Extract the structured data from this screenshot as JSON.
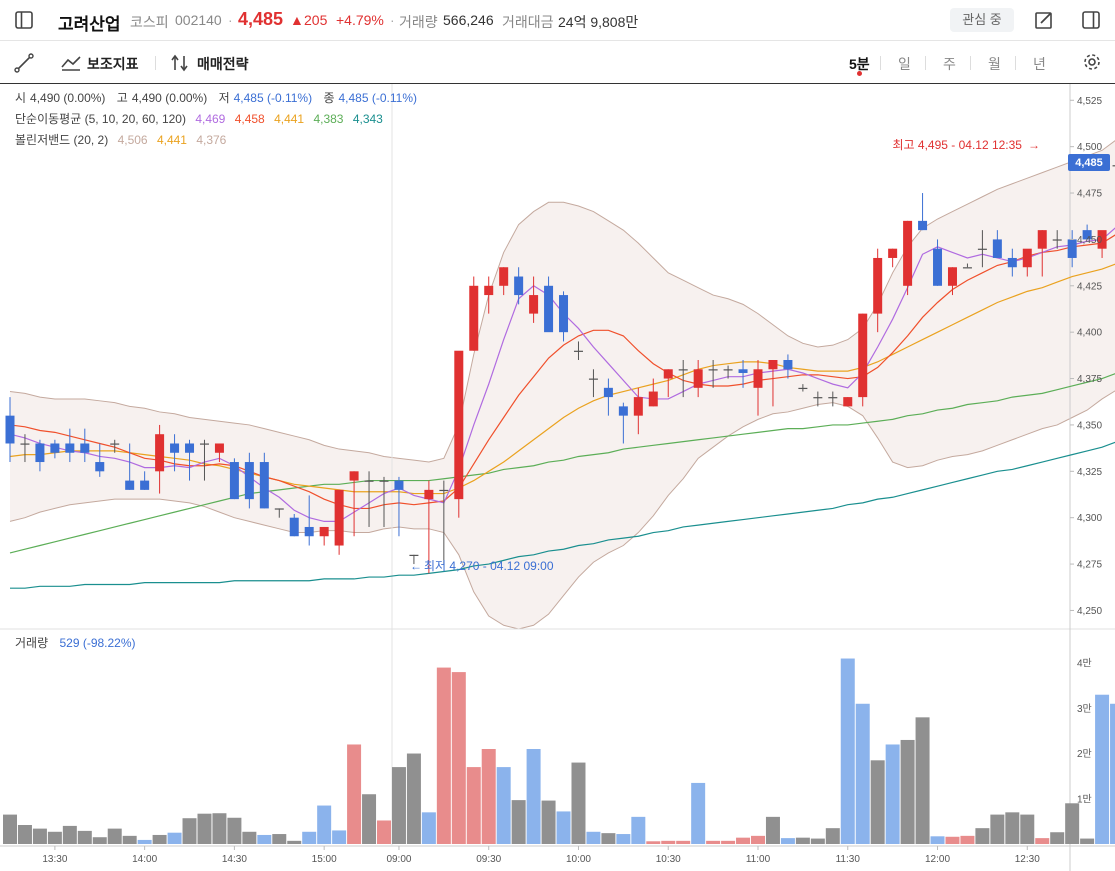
{
  "header": {
    "name": "고려산업",
    "market": "코스피",
    "code": "002140",
    "price": "4,485",
    "change": "205",
    "change_pct": "+4.79%",
    "volume_label": "거래량",
    "volume": "566,246",
    "amount_label": "거래대금",
    "amount": "24억 9,808만",
    "fav_label": "관심 중"
  },
  "toolbar": {
    "indicator_label": "보조지표",
    "strategy_label": "매매전략",
    "periods": [
      "5분",
      "일",
      "주",
      "월",
      "년"
    ],
    "active_period": "5분"
  },
  "legend": {
    "ohlc": [
      {
        "label": "시",
        "value": "4,490 (0.00%)",
        "color": "#444444"
      },
      {
        "label": "고",
        "value": "4,490 (0.00%)",
        "color": "#444444"
      },
      {
        "label": "저",
        "value": "4,485 (-0.11%)",
        "color": "#3b6fd4"
      },
      {
        "label": "종",
        "value": "4,485 (-0.11%)",
        "color": "#3b6fd4"
      }
    ],
    "sma_label": "단순이동평균 (5, 10, 20, 60, 120)",
    "sma_values": [
      {
        "value": "4,469",
        "color": "#b06be0"
      },
      {
        "value": "4,458",
        "color": "#f0502c"
      },
      {
        "value": "4,441",
        "color": "#eaa21f"
      },
      {
        "value": "4,383",
        "color": "#5cae57"
      },
      {
        "value": "4,343",
        "color": "#1a8f8f"
      }
    ],
    "bb_label": "볼린저밴드 (20, 2)",
    "bb_values": [
      {
        "value": "4,506",
        "color": "#c4a99e"
      },
      {
        "value": "4,441",
        "color": "#eaa21f"
      },
      {
        "value": "4,376",
        "color": "#c4a99e"
      }
    ],
    "volume_label": "거래량",
    "volume_value": "529 (-98.22%)"
  },
  "annotations": {
    "high": "최고 4,495 - 04.12 12:35",
    "low": "최저 4,270 - 04.12 09:00",
    "current_price_tag": "4,485"
  },
  "colors": {
    "up": "#e03131",
    "down": "#3b6fd4",
    "neutral": "#555555"
  },
  "chart_data": [
    {
      "type": "candlestick",
      "ylim": [
        4240,
        4530
      ],
      "y_ticks": [
        "4,525",
        "4,500",
        "4,475",
        "4,450",
        "4,425",
        "4,400",
        "4,375",
        "4,350",
        "4,325",
        "4,300",
        "4,275",
        "4,250"
      ],
      "x_ticks": [
        "13:30",
        "14:00",
        "14:30",
        "15:00",
        "09:00",
        "09:30",
        "10:00",
        "10:30",
        "11:00",
        "11:30",
        "12:00",
        "12:30"
      ],
      "candles": [
        [
          4355,
          4365,
          4330,
          4340
        ],
        [
          4340,
          4345,
          4330,
          4340
        ],
        [
          4340,
          4342,
          4325,
          4330
        ],
        [
          4340,
          4342,
          4332,
          4335
        ],
        [
          4340,
          4348,
          4330,
          4335
        ],
        [
          4340,
          4348,
          4330,
          4335
        ],
        [
          4330,
          4340,
          4322,
          4325
        ],
        [
          4340,
          4342,
          4335,
          4340
        ],
        [
          4320,
          4340,
          4315,
          4315
        ],
        [
          4320,
          4325,
          4315,
          4315
        ],
        [
          4325,
          4350,
          4313,
          4345
        ],
        [
          4340,
          4345,
          4325,
          4335
        ],
        [
          4340,
          4342,
          4320,
          4335
        ],
        [
          4340,
          4342,
          4320,
          4340
        ],
        [
          4335,
          4340,
          4330,
          4340
        ],
        [
          4330,
          4332,
          4310,
          4310
        ],
        [
          4330,
          4335,
          4305,
          4310
        ],
        [
          4330,
          4335,
          4305,
          4305
        ],
        [
          4305,
          4305,
          4300,
          4305
        ],
        [
          4300,
          4302,
          4290,
          4290
        ],
        [
          4295,
          4312,
          4285,
          4290
        ],
        [
          4290,
          4295,
          4285,
          4295
        ],
        [
          4285,
          4315,
          4280,
          4315
        ],
        [
          4320,
          4325,
          4290,
          4325
        ],
        [
          4320,
          4325,
          4295,
          4320
        ],
        [
          4320,
          4322,
          4295,
          4320
        ],
        [
          4320,
          4322,
          4290,
          4315
        ],
        [
          4280,
          4280,
          4275,
          4280
        ],
        [
          4310,
          4320,
          4270,
          4315
        ],
        [
          4315,
          4320,
          4275,
          4315
        ],
        [
          4310,
          4320,
          4300,
          4390
        ],
        [
          4390,
          4430,
          4390,
          4425
        ],
        [
          4420,
          4430,
          4410,
          4425
        ],
        [
          4425,
          4435,
          4420,
          4435
        ],
        [
          4430,
          4435,
          4415,
          4420
        ],
        [
          4410,
          4430,
          4405,
          4420
        ],
        [
          4425,
          4430,
          4405,
          4400
        ],
        [
          4420,
          4422,
          4395,
          4400
        ],
        [
          4390,
          4395,
          4385,
          4390
        ],
        [
          4375,
          4380,
          4365,
          4375
        ],
        [
          4370,
          4375,
          4355,
          4365
        ],
        [
          4360,
          4362,
          4340,
          4355
        ],
        [
          4355,
          4370,
          4345,
          4365
        ],
        [
          4360,
          4375,
          4360,
          4368
        ],
        [
          4375,
          4380,
          4365,
          4380
        ],
        [
          4380,
          4385,
          4365,
          4380
        ],
        [
          4370,
          4385,
          4365,
          4380
        ],
        [
          4380,
          4385,
          4370,
          4380
        ],
        [
          4380,
          4382,
          4375,
          4380
        ],
        [
          4380,
          4385,
          4370,
          4378
        ],
        [
          4370,
          4385,
          4355,
          4380
        ],
        [
          4380,
          4382,
          4360,
          4385
        ],
        [
          4385,
          4388,
          4375,
          4380
        ],
        [
          4370,
          4372,
          4368,
          4370
        ],
        [
          4365,
          4368,
          4360,
          4365
        ],
        [
          4365,
          4368,
          4360,
          4365
        ],
        [
          4360,
          4365,
          4360,
          4365
        ],
        [
          4365,
          4410,
          4360,
          4410
        ],
        [
          4410,
          4445,
          4400,
          4440
        ],
        [
          4440,
          4445,
          4435,
          4445
        ],
        [
          4425,
          4460,
          4420,
          4460
        ],
        [
          4460,
          4475,
          4455,
          4455
        ],
        [
          4445,
          4450,
          4425,
          4425
        ],
        [
          4425,
          4435,
          4420,
          4435
        ],
        [
          4435,
          4437,
          4435,
          4435
        ],
        [
          4445,
          4455,
          4435,
          4445
        ],
        [
          4450,
          4455,
          4440,
          4440
        ],
        [
          4440,
          4445,
          4430,
          4435
        ],
        [
          4435,
          4440,
          4430,
          4445
        ],
        [
          4445,
          4455,
          4430,
          4455
        ],
        [
          4450,
          4455,
          4445,
          4450
        ],
        [
          4450,
          4455,
          4435,
          4440
        ],
        [
          4455,
          4458,
          4450,
          4450
        ],
        [
          4445,
          4450,
          4440,
          4455
        ],
        [
          4490,
          4495,
          4470,
          4490
        ],
        [
          4490,
          4490,
          4485,
          4485
        ]
      ],
      "sma5": [
        4345,
        4343,
        4340,
        4338,
        4336,
        4335,
        4333,
        4332,
        4330,
        4327,
        4327,
        4328,
        4327,
        4330,
        4332,
        4328,
        4322,
        4316,
        4311,
        4304,
        4300,
        4298,
        4298,
        4303,
        4308,
        4313,
        4316,
        4312,
        4310,
        4308,
        4326,
        4350,
        4372,
        4396,
        4418,
        4425,
        4420,
        4410,
        4402,
        4392,
        4383,
        4374,
        4365,
        4364,
        4364,
        4368,
        4372,
        4374,
        4376,
        4376,
        4378,
        4379,
        4380,
        4378,
        4375,
        4372,
        4370,
        4378,
        4392,
        4407,
        4424,
        4442,
        4446,
        4443,
        4440,
        4442,
        4440,
        4438,
        4440,
        4443,
        4446,
        4447,
        4449,
        4450,
        4457,
        4469
      ],
      "sma10": [
        4350,
        4349,
        4347,
        4346,
        4344,
        4342,
        4340,
        4338,
        4335,
        4332,
        4331,
        4329,
        4328,
        4328,
        4329,
        4328,
        4325,
        4322,
        4320,
        4317,
        4314,
        4310,
        4307,
        4305,
        4305,
        4307,
        4308,
        4307,
        4308,
        4309,
        4316,
        4329,
        4342,
        4354,
        4366,
        4376,
        4386,
        4393,
        4398,
        4401,
        4401,
        4398,
        4390,
        4383,
        4378,
        4374,
        4372,
        4371,
        4371,
        4372,
        4374,
        4375,
        4376,
        4377,
        4377,
        4376,
        4375,
        4376,
        4381,
        4389,
        4398,
        4408,
        4416,
        4423,
        4428,
        4432,
        4436,
        4438,
        4441,
        4443,
        4444,
        4446,
        4447,
        4448,
        4453,
        4458
      ],
      "sma20": [
        4333,
        4334,
        4334,
        4335,
        4336,
        4336,
        4336,
        4336,
        4335,
        4334,
        4333,
        4332,
        4331,
        4329,
        4328,
        4326,
        4324,
        4322,
        4320,
        4318,
        4317,
        4316,
        4315,
        4314,
        4314,
        4314,
        4314,
        4313,
        4313,
        4313,
        4316,
        4320,
        4325,
        4330,
        4336,
        4342,
        4348,
        4354,
        4359,
        4363,
        4366,
        4368,
        4370,
        4372,
        4374,
        4377,
        4380,
        4382,
        4383,
        4384,
        4384,
        4383,
        4381,
        4380,
        4379,
        4379,
        4379,
        4381,
        4384,
        4388,
        4392,
        4396,
        4400,
        4404,
        4408,
        4412,
        4416,
        4419,
        4422,
        4424,
        4427,
        4430,
        4432,
        4434,
        4437,
        4441
      ],
      "sma60": [
        4281,
        4283,
        4285,
        4287,
        4289,
        4291,
        4293,
        4295,
        4297,
        4299,
        4301,
        4303,
        4305,
        4307,
        4309,
        4311,
        4313,
        4314,
        4315,
        4316,
        4317,
        4318,
        4318,
        4319,
        4320,
        4320,
        4320,
        4320,
        4320,
        4321,
        4322,
        4323,
        4324,
        4326,
        4327,
        4328,
        4330,
        4331,
        4333,
        4334,
        4335,
        4337,
        4338,
        4339,
        4340,
        4341,
        4342,
        4343,
        4344,
        4345,
        4346,
        4347,
        4348,
        4348,
        4349,
        4350,
        4350,
        4351,
        4352,
        4353,
        4355,
        4356,
        4358,
        4359,
        4361,
        4362,
        4363,
        4365,
        4366,
        4367,
        4369,
        4371,
        4373,
        4375,
        4378,
        4383
      ],
      "sma120": [
        4262,
        4262,
        4263,
        4263,
        4263,
        4264,
        4264,
        4264,
        4264,
        4265,
        4265,
        4265,
        4265,
        4265,
        4265,
        4266,
        4266,
        4266,
        4266,
        4266,
        4266,
        4267,
        4267,
        4267,
        4268,
        4268,
        4269,
        4269,
        4270,
        4271,
        4272,
        4274,
        4275,
        4277,
        4279,
        4280,
        4282,
        4283,
        4285,
        4286,
        4288,
        4289,
        4290,
        4292,
        4293,
        4295,
        4296,
        4297,
        4298,
        4299,
        4300,
        4301,
        4302,
        4303,
        4304,
        4305,
        4307,
        4308,
        4310,
        4311,
        4313,
        4315,
        4317,
        4319,
        4321,
        4323,
        4325,
        4326,
        4328,
        4330,
        4332,
        4334,
        4336,
        4338,
        4341,
        4343
      ],
      "bb_upper": [
        4368,
        4367,
        4365,
        4364,
        4364,
        4364,
        4363,
        4362,
        4360,
        4359,
        4357,
        4356,
        4354,
        4353,
        4352,
        4351,
        4350,
        4348,
        4346,
        4344,
        4342,
        4339,
        4337,
        4336,
        4335,
        4333,
        4332,
        4331,
        4330,
        4332,
        4350,
        4388,
        4420,
        4443,
        4458,
        4465,
        4470,
        4470,
        4468,
        4465,
        4460,
        4455,
        4448,
        4440,
        4432,
        4428,
        4424,
        4420,
        4418,
        4415,
        4410,
        4404,
        4398,
        4394,
        4392,
        4393,
        4396,
        4402,
        4415,
        4432,
        4446,
        4456,
        4461,
        4465,
        4469,
        4473,
        4477,
        4480,
        4483,
        4486,
        4489,
        4492,
        4495,
        4498,
        4504,
        4506
      ],
      "bb_lower": [
        4298,
        4300,
        4303,
        4305,
        4307,
        4308,
        4309,
        4310,
        4310,
        4310,
        4310,
        4309,
        4308,
        4306,
        4303,
        4300,
        4298,
        4296,
        4294,
        4292,
        4292,
        4293,
        4293,
        4292,
        4292,
        4294,
        4295,
        4294,
        4294,
        4292,
        4280,
        4260,
        4247,
        4242,
        4240,
        4242,
        4248,
        4258,
        4268,
        4276,
        4281,
        4285,
        4292,
        4301,
        4312,
        4321,
        4332,
        4338,
        4344,
        4349,
        4353,
        4356,
        4357,
        4359,
        4361,
        4362,
        4360,
        4355,
        4343,
        4330,
        4327,
        4328,
        4331,
        4333,
        4334,
        4336,
        4339,
        4342,
        4345,
        4348,
        4350,
        4354,
        4358,
        4364,
        4369,
        4376
      ],
      "volume": [
        6500,
        4200,
        3400,
        2700,
        4000,
        2900,
        1500,
        3400,
        1800,
        900,
        2000,
        2500,
        5700,
        6700,
        6800,
        5800,
        2700,
        2000,
        2200,
        700,
        2700,
        8500,
        3000,
        22000,
        11000,
        5200,
        17000,
        20000,
        7000,
        39000,
        38000,
        17000,
        21000,
        17000,
        9700,
        21000,
        9600,
        7200,
        18000,
        2700,
        2400,
        2200,
        6000,
        600,
        700,
        700,
        13500,
        700,
        700,
        1400,
        1800,
        6000,
        1300,
        1400,
        1200,
        3500,
        41000,
        31000,
        18500,
        22000,
        23000,
        28000,
        1700,
        1600,
        1800,
        3500,
        6500,
        7000,
        6500,
        1300,
        2600,
        9000,
        1200,
        33000,
        31000,
        600
      ],
      "vol_colors": [
        2,
        2,
        2,
        2,
        2,
        2,
        2,
        2,
        2,
        1,
        2,
        1,
        2,
        2,
        2,
        2,
        2,
        1,
        2,
        2,
        1,
        1,
        1,
        0,
        2,
        0,
        2,
        2,
        1,
        0,
        0,
        0,
        0,
        1,
        2,
        1,
        2,
        1,
        2,
        1,
        2,
        1,
        1,
        0,
        0,
        0,
        1,
        0,
        0,
        0,
        0,
        2,
        1,
        2,
        2,
        2,
        1,
        1,
        2,
        1,
        2,
        2,
        1,
        0,
        0,
        2,
        2,
        2,
        2,
        0,
        2,
        2,
        2,
        1,
        1,
        2
      ]
    }
  ]
}
